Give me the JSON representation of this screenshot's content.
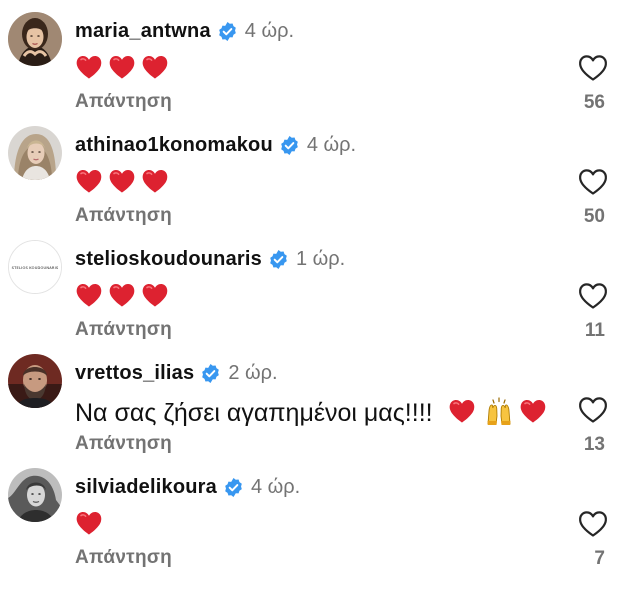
{
  "comments": [
    {
      "username": "maria_antwna",
      "time": "4 ώρ.",
      "text": "",
      "emojis": [
        "red-heart",
        "red-heart",
        "red-heart"
      ],
      "reply_label": "Απάντηση",
      "likes": "56",
      "avatar": "woman-portrait-avatar"
    },
    {
      "username": "athinao1konomakou",
      "time": "4 ώρ.",
      "text": "",
      "emojis": [
        "red-heart",
        "red-heart",
        "red-heart"
      ],
      "reply_label": "Απάντηση",
      "likes": "50",
      "avatar": "woman-blonde-avatar"
    },
    {
      "username": "stelioskoudounaris",
      "time": "1 ώρ.",
      "text": "",
      "emojis": [
        "red-heart",
        "red-heart",
        "red-heart"
      ],
      "reply_label": "Απάντηση",
      "likes": "11",
      "avatar": "brand-logo-avatar",
      "avatar_logo_text": "STELIOS KOUDOUNARIS"
    },
    {
      "username": "vrettos_ilias",
      "time": "2 ώρ.",
      "text": "Να σας ζήσει αγαπημένοι μας!!!!",
      "emojis": [
        "red-heart",
        "raising-hands",
        "red-heart"
      ],
      "reply_label": "Απάντηση",
      "likes": "13",
      "avatar": "man-bearded-avatar"
    },
    {
      "username": "silviadelikoura",
      "time": "4 ώρ.",
      "text": "",
      "emojis": [
        "red-heart"
      ],
      "reply_label": "Απάντηση",
      "likes": "7",
      "avatar": "woman-bw-avatar"
    }
  ],
  "colors": {
    "verified_badge": "#3897f0",
    "muted_text": "#737373",
    "heart_red": "#e0242c",
    "like_outline": "#262626"
  },
  "icons": {
    "verified": "verified-badge-icon",
    "like": "heart-outline-icon"
  }
}
